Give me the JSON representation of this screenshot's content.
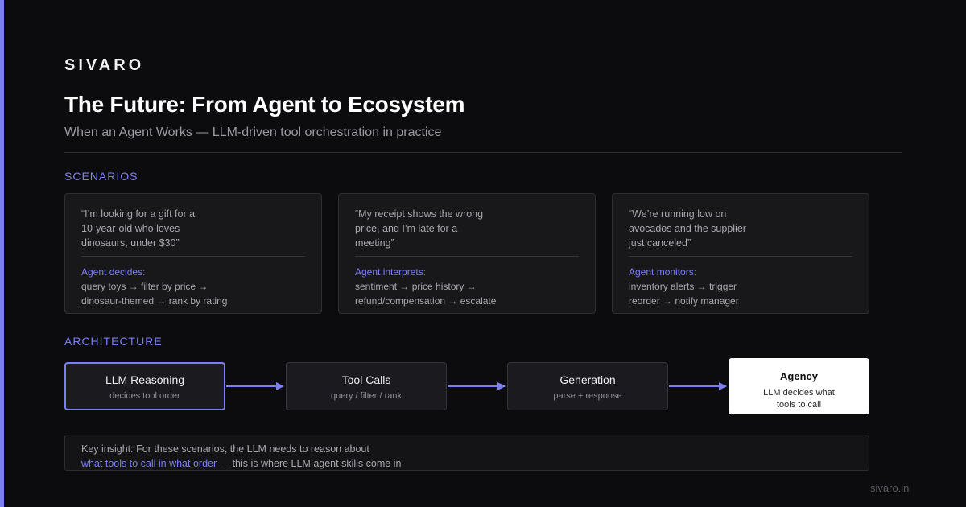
{
  "brand": "SIVARO",
  "title": "The Future: From Agent to Ecosystem",
  "subtitle": "When an Agent Works — LLM-driven tool orchestration in practice",
  "scenarios_label": "SCENARIOS",
  "scenarios": [
    {
      "quote_lines": [
        "“I’m looking for a gift for a",
        "10-year-old who loves",
        "dinosaurs, under $30”"
      ],
      "decide_label": "Agent decides:",
      "decide_lines": [
        "query toys → filter by price →",
        "dinosaur-themed → rank by rating"
      ]
    },
    {
      "quote_lines": [
        "“My receipt shows the wrong",
        "price, and I’m late for a",
        "meeting”"
      ],
      "decide_label": "Agent interprets:",
      "decide_lines": [
        "sentiment → price history →",
        "refund/compensation → escalate"
      ]
    },
    {
      "quote_lines": [
        "“We’re running low on",
        "avocados and the supplier",
        "just canceled”"
      ],
      "decide_label": "Agent monitors:",
      "decide_lines": [
        "inventory alerts → trigger",
        "reorder → notify manager"
      ]
    }
  ],
  "architecture_label": "ARCHITECTURE",
  "architecture": [
    {
      "title": "LLM Reasoning",
      "subtitle": "decides tool order"
    },
    {
      "title": "Tool Calls",
      "subtitle": "query / filter / rank"
    },
    {
      "title": "Generation",
      "subtitle": "parse + response"
    }
  ],
  "agency": {
    "title": "Agency",
    "line1": "LLM decides what",
    "line2": "tools to call"
  },
  "insight": {
    "line1": "Key insight: For these scenarios, the LLM needs to reason about",
    "highlight": "what tools to call in what order",
    "rest": " — this is where LLM agent skills come in"
  },
  "footer": "sivaro.in",
  "colors": {
    "accent": "#7b7ff0",
    "background": "#0c0c0e",
    "card": "#18181b",
    "agency_bg": "#ffffff"
  }
}
